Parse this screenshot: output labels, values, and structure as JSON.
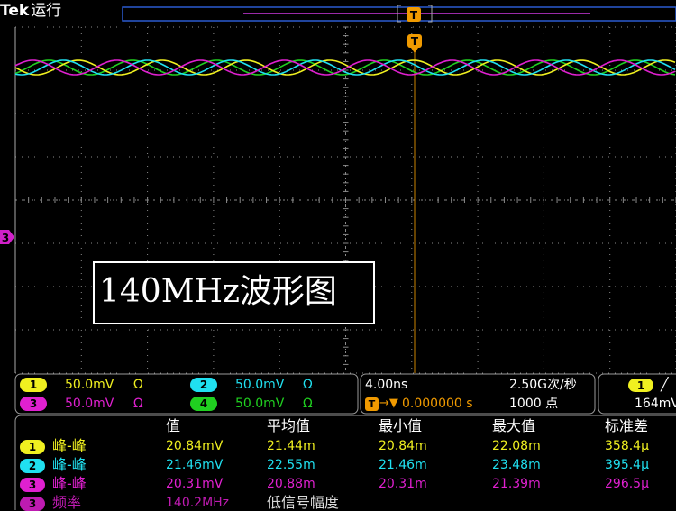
{
  "header": {
    "brand": "Tek",
    "status": "运行"
  },
  "trigger": {
    "marker_top": "T",
    "marker_main": "T"
  },
  "channel_marker": "3",
  "overlay_label": "140MHz波形图",
  "colors": {
    "ch1": "#f0f020",
    "ch2": "#20e0f0",
    "ch3": "#e020d0",
    "ch4": "#20d020",
    "grid": "#8a8a8a",
    "trigger": "#f09a00"
  },
  "channels": [
    {
      "num": "1",
      "scale": "50.0mV",
      "coupling": "Ω"
    },
    {
      "num": "2",
      "scale": "50.0mV",
      "coupling": "Ω"
    },
    {
      "num": "3",
      "scale": "50.0mV",
      "coupling": "Ω"
    },
    {
      "num": "4",
      "scale": "50.0mV",
      "coupling": "Ω"
    }
  ],
  "timebase": {
    "scale": "4.00ns",
    "sample_rate": "2.50G次/秒",
    "record_length": "1000 点",
    "trigger_arrow": "→▼",
    "trigger_position": "0.000000 s"
  },
  "trigger_info": {
    "channel": "1",
    "slope_icon": "╱",
    "level": "164mV"
  },
  "measurements": {
    "headers": [
      "值",
      "平均值",
      "最小值",
      "最大值",
      "标准差"
    ],
    "rows": [
      {
        "ch": "1",
        "name": "峰-峰",
        "value": "20.84mV",
        "mean": "21.44m",
        "min": "20.84m",
        "max": "22.08m",
        "std": "358.4μ"
      },
      {
        "ch": "2",
        "name": "峰-峰",
        "value": "21.46mV",
        "mean": "22.55m",
        "min": "21.46m",
        "max": "23.48m",
        "std": "395.4μ"
      },
      {
        "ch": "3",
        "name": "峰-峰",
        "value": "20.31mV",
        "mean": "20.88m",
        "min": "20.31m",
        "max": "21.39m",
        "std": "296.5μ"
      },
      {
        "ch": "3",
        "name": "频率",
        "value": "140.2MHz",
        "mean": "低信号幅度",
        "min": "",
        "max": "",
        "std": ""
      }
    ]
  }
}
